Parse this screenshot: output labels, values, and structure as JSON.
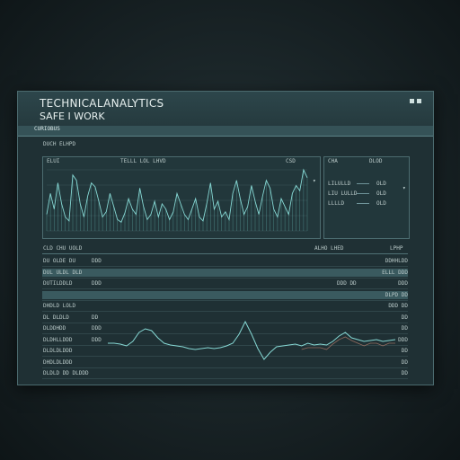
{
  "header": {
    "title_line1": "TECHNICALANALYTICS",
    "title_line2": "SAFE I WORK",
    "section_label": "CURIOBUS",
    "subheading": "DUCH ELHPD"
  },
  "main_chart": {
    "label_left": "ELUI",
    "label_center": "TELLL LOL LHVD",
    "label_right": "CSD",
    "series": [
      14,
      30,
      18,
      38,
      22,
      12,
      9,
      44,
      40,
      22,
      12,
      28,
      38,
      35,
      24,
      12,
      16,
      30,
      20,
      10,
      8,
      15,
      26,
      18,
      14,
      34,
      20,
      10,
      14,
      24,
      12,
      22,
      18,
      10,
      16,
      30,
      22,
      14,
      10,
      18,
      26,
      12,
      9,
      22,
      38,
      18,
      24,
      12,
      16,
      10,
      30,
      40,
      26,
      14,
      20,
      36,
      24,
      14,
      28,
      40,
      34,
      18,
      12,
      26,
      20,
      14,
      30,
      36,
      32,
      48,
      42
    ]
  },
  "side_panel": {
    "header_left": "CHA",
    "header_right": "DLOD",
    "rows": [
      {
        "label": "LILULLD",
        "value": "OLD"
      },
      {
        "label": "LIU LULLD",
        "value": "OLD"
      },
      {
        "label": "LLLLD",
        "value": "OLD"
      }
    ]
  },
  "table": {
    "header": {
      "left": "CLD CHU UOLD",
      "right1": "ALHO LHED",
      "right2": "LPHP"
    },
    "rows": [
      {
        "label": "DU OLDE DU",
        "value": "DDD",
        "right": "DDHHLDD"
      },
      {
        "label": "DUL ULDL DLD",
        "value": "",
        "right": "ELLL DDD",
        "highlighted": true
      },
      {
        "label": "DUTILDDLD",
        "value": "DDD",
        "mid": "DDD DD",
        "right": "DDD"
      },
      {
        "label": "",
        "value": "",
        "right": "DLPD DD",
        "highlighted": true
      },
      {
        "label": "DHDLD LOLD",
        "value": "",
        "right": "DDD DD"
      },
      {
        "label": "DL DLDLD",
        "value": "DD",
        "right": "DD"
      },
      {
        "label": "DLDDHDD",
        "value": "DDD",
        "right": "DD"
      },
      {
        "label": "DLDHLLDDD",
        "value": "DDD",
        "right": "DDD"
      },
      {
        "label": "DLDLDLDDD",
        "value": "",
        "right": "DD"
      },
      {
        "label": "DHDLDLDDD",
        "value": "",
        "right": "DD"
      },
      {
        "label": "DLDLD DD DLDDD",
        "value": "",
        "right": "DD"
      }
    ]
  },
  "wave_chart": {
    "series": [
      30,
      30,
      31,
      33,
      28,
      18,
      14,
      16,
      24,
      30,
      32,
      33,
      34,
      36,
      37,
      36,
      35,
      36,
      35,
      33,
      30,
      20,
      6,
      20,
      36,
      48,
      40,
      34,
      33,
      32,
      31,
      33,
      30,
      32,
      31,
      32,
      28,
      22,
      18,
      24,
      26,
      28,
      27,
      26,
      28,
      27,
      26
    ]
  },
  "colors": {
    "accent": "#86d8d4",
    "panel": "#22373b",
    "highlight": "#3a5a5f"
  }
}
